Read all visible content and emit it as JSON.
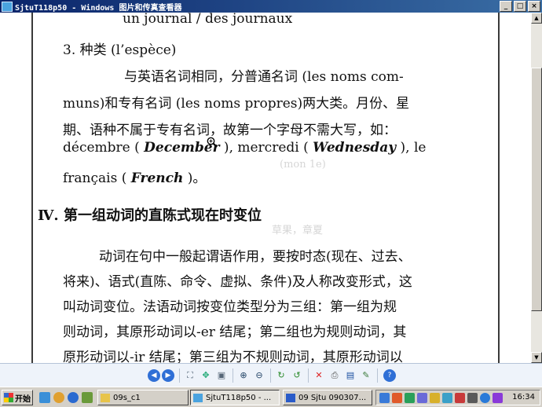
{
  "window": {
    "title": "SjtuT118p50 - Windows 图片和传真查看器"
  },
  "title_controls": {
    "minimize": "_",
    "maximize": "□",
    "close": "×"
  },
  "document": {
    "line_top": "un journal / des journaux",
    "section3_title": "3.  种类 (l’espèce)",
    "p1_l1": "与英语名词相同，分普通名词 (les noms com-",
    "p1_l2": "muns)和专有名词 (les noms propres)两大类。月份、星",
    "p1_l3": "期、语种不属于专有名词，故第一个字母不需大写，如：",
    "p1_l4_a": "décembre ( ",
    "p1_l4_b": "December",
    "p1_l4_c": " ),  mercredi ( ",
    "p1_l4_d": "Wednesday",
    "p1_l4_e": " ),  le",
    "p1_l5_a": "français ( ",
    "p1_l5_b": "French",
    "p1_l5_c": " )。",
    "heading4": "Ⅳ.  第一组动词的直陈式现在时变位",
    "p2_l1": "动词在句中一般起谓语作用，要按时态(现在、过去、",
    "p2_l2": "将来)、语式(直陈、命令、虚拟、条件)及人称改变形式，这",
    "p2_l3": "叫动词变位。法语动词按变位类型分为三组：第一组为规",
    "p2_l4": "则动词，其原形动词以-er 结尾；第二组也为规则动词，其",
    "p2_l5": "原形动词以-ir 结尾；第三组为不规则动词，其原形动词以",
    "ghost_1": "(mon 1e)",
    "ghost_2": "草果，章夏"
  },
  "taskbar": {
    "start": "开始",
    "tasks": [
      "09s_c1",
      "SjtuT118p50 - ...",
      "09 Sjtu 090307..."
    ],
    "clock": "16:34"
  },
  "colors": {
    "titlebar": "#0a246a",
    "titlebar_end": "#3a6ea5",
    "face": "#d4d0c8",
    "toolbar_bg": "#eef3fa"
  }
}
